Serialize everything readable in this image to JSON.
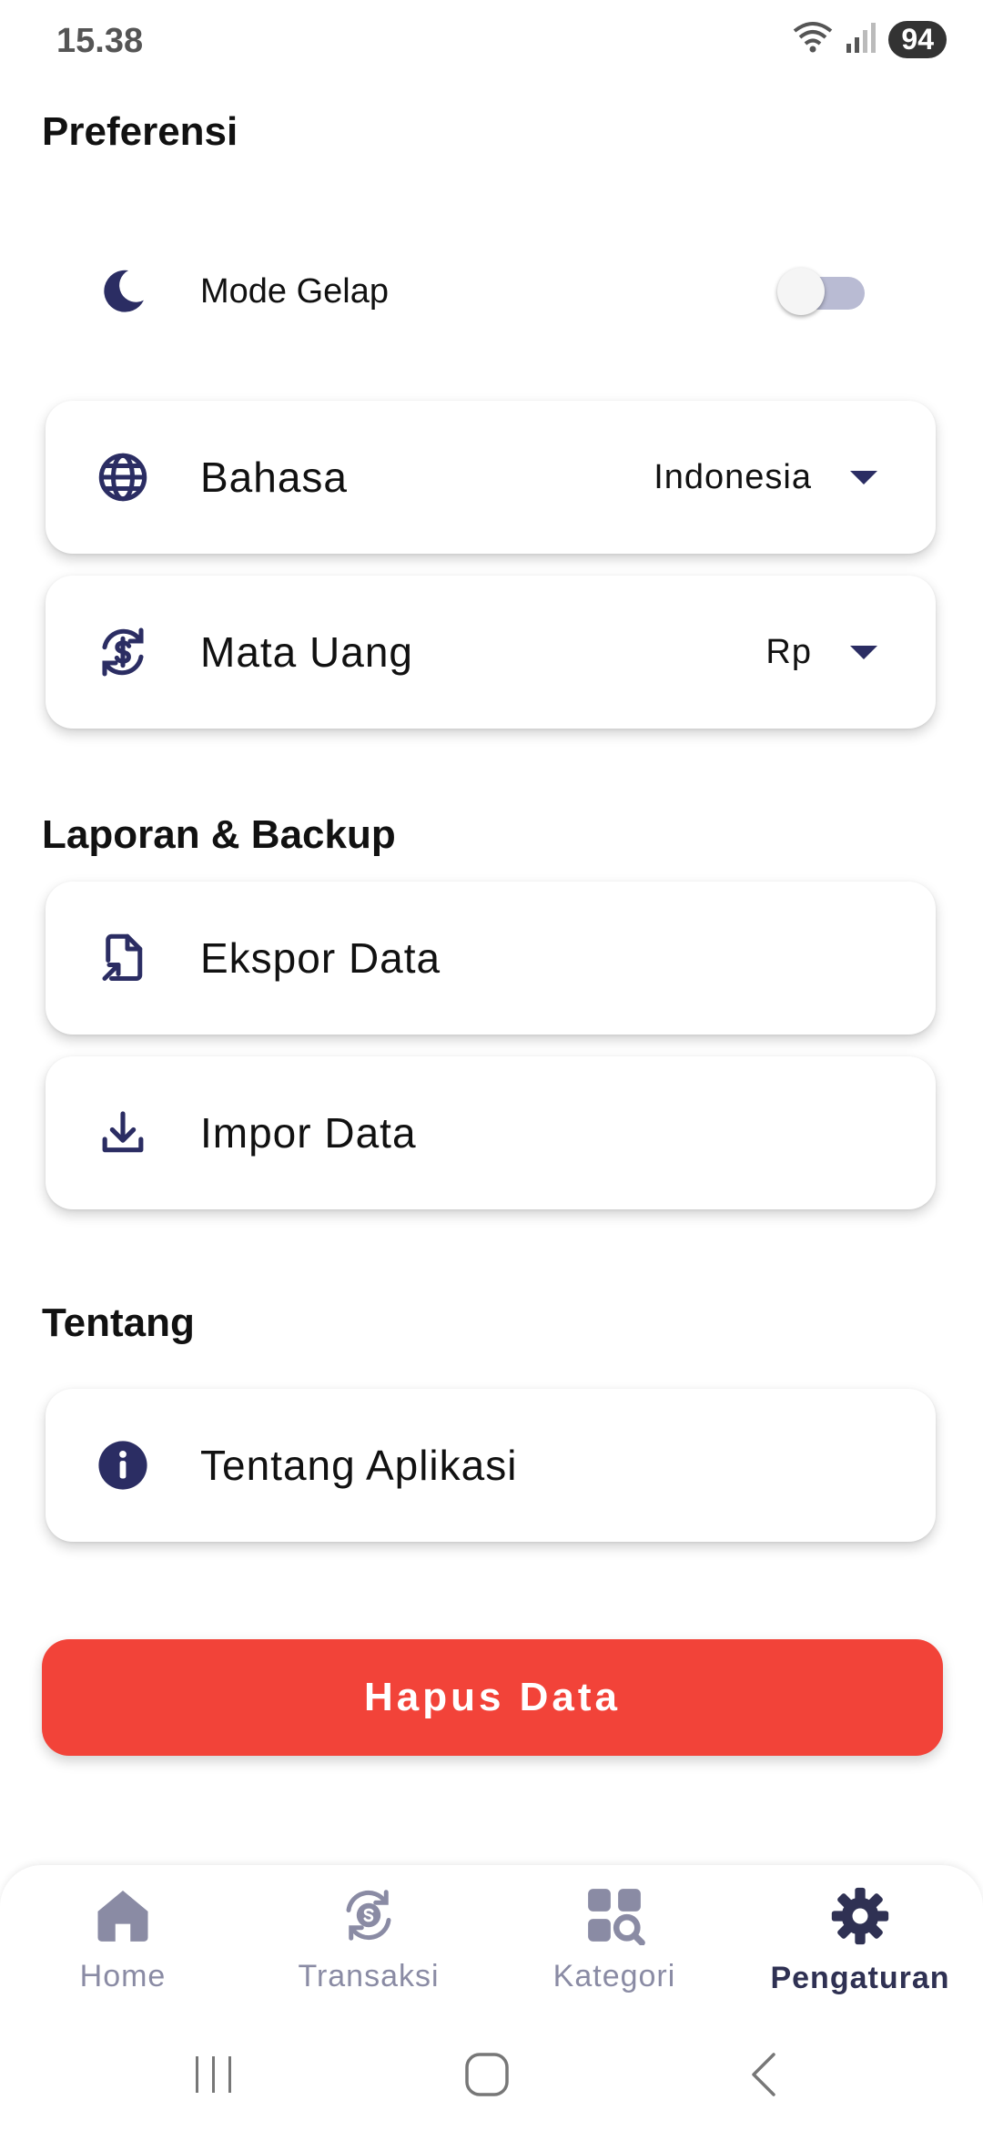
{
  "status_bar": {
    "time": "15.38",
    "battery": "94",
    "network_badge": "5"
  },
  "preferences": {
    "title": "Preferensi",
    "dark_mode": {
      "label": "Mode Gelap",
      "enabled": false,
      "icon": "moon-icon"
    },
    "language": {
      "label": "Bahasa",
      "value": "Indonesia",
      "icon": "globe-icon"
    },
    "currency": {
      "label": "Mata Uang",
      "value": "Rp",
      "icon": "currency-exchange-icon"
    }
  },
  "report_backup": {
    "title": "Laporan & Backup",
    "export": {
      "label": "Ekspor Data",
      "icon": "file-export-icon"
    },
    "import": {
      "label": "Impor Data",
      "icon": "download-icon"
    }
  },
  "about": {
    "title": "Tentang",
    "app_info": {
      "label": "Tentang Aplikasi",
      "icon": "info-icon"
    }
  },
  "danger": {
    "delete_label": "Hapus Data",
    "color": "#f24339"
  },
  "bottom_nav": {
    "items": [
      {
        "label": "Home",
        "icon": "home-icon",
        "active": false
      },
      {
        "label": "Transaksi",
        "icon": "transaction-icon",
        "active": false
      },
      {
        "label": "Kategori",
        "icon": "category-icon",
        "active": false
      },
      {
        "label": "Pengaturan",
        "icon": "gear-icon",
        "active": true
      }
    ]
  },
  "colors": {
    "primary": "#2b2d63",
    "inactive": "#8a8ba4",
    "danger": "#f24339"
  }
}
